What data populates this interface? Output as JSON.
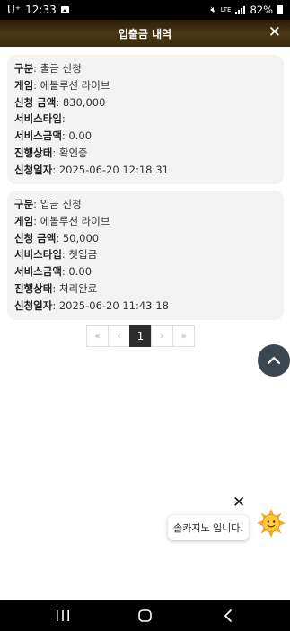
{
  "status_bar": {
    "carrier": "U⁺",
    "time": "12:33",
    "network": "LTE",
    "battery": "82%"
  },
  "header": {
    "title": "입출금 내역"
  },
  "records": [
    {
      "rows": [
        {
          "key": "구분",
          "value": " 출금 신청"
        },
        {
          "key": "게임",
          "value": " 에볼루션 라이브"
        },
        {
          "key": "신청 금액",
          "value": " 830,000"
        },
        {
          "key": "서비스타입",
          "value": " "
        },
        {
          "key": "서비스금액",
          "value": " 0.00"
        },
        {
          "key": "진행상태",
          "value": " 확인중"
        },
        {
          "key": "신청일자",
          "value": " 2025-06-20 12:18:31"
        }
      ]
    },
    {
      "rows": [
        {
          "key": "구분",
          "value": " 입금 신청"
        },
        {
          "key": "게임",
          "value": " 에볼루션 라이브"
        },
        {
          "key": "신청 금액",
          "value": " 50,000"
        },
        {
          "key": "서비스타입",
          "value": " 첫입금"
        },
        {
          "key": "서비스금액",
          "value": " 0.00"
        },
        {
          "key": "진행상태",
          "value": " 처리완료"
        },
        {
          "key": "신청일자",
          "value": " 2025-06-20 11:43:18"
        }
      ]
    }
  ],
  "pagination": {
    "first": "«",
    "prev": "‹",
    "current": "1",
    "next": "›",
    "last": "»"
  },
  "chat": {
    "message": "솔카지노 입니다."
  },
  "colors": {
    "header_bg": "#3a2a0e",
    "card_bg": "#f3f3f3",
    "page_active": "#2c2c2c",
    "scroll_btn": "#3b4650"
  },
  "icons": [
    "close-icon",
    "chevron-up-icon",
    "sun-mascot-icon",
    "recent-apps-icon",
    "home-icon",
    "back-icon"
  ]
}
